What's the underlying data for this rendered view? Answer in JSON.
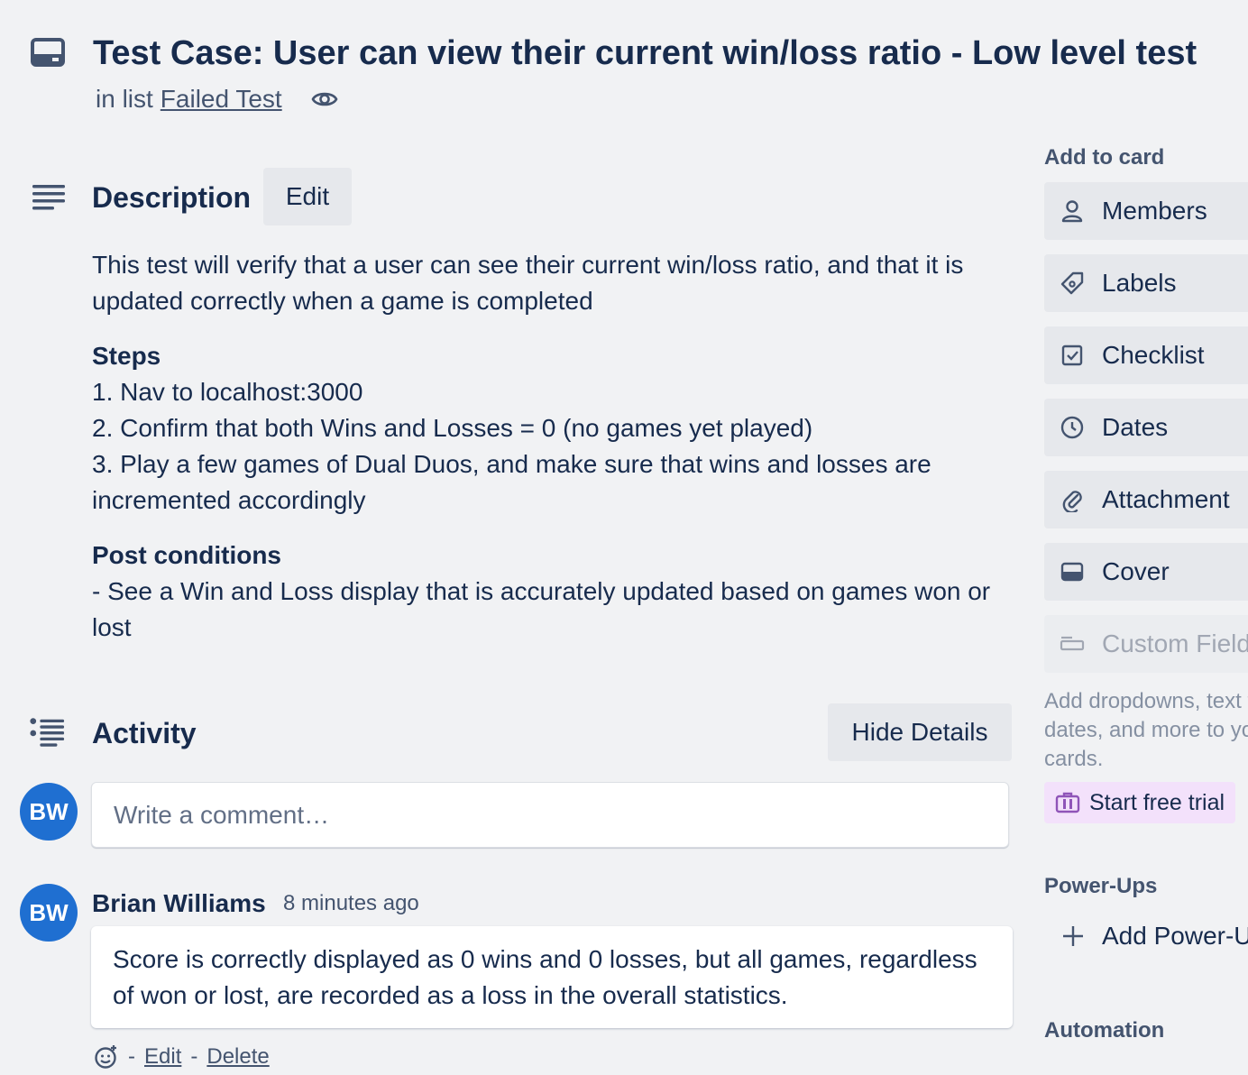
{
  "card": {
    "title": "Test Case: User can view their current win/loss ratio - Low level test",
    "list_prefix": "in list",
    "list_name": "Failed Test"
  },
  "description": {
    "heading": "Description",
    "edit_label": "Edit",
    "intro": "This test will verify that a user can see their current win/loss ratio, and that it is updated correctly when a game is completed",
    "steps_heading": "Steps",
    "steps": [
      "1. Nav to localhost:3000",
      "2. Confirm that both Wins and Losses = 0 (no games yet played)",
      "3. Play a few games of Dual Duos, and make sure that wins and losses are incremented accordingly"
    ],
    "post_heading": "Post conditions",
    "post_text": "- See a Win and Loss display that is accurately updated based on games won or lost"
  },
  "activity": {
    "heading": "Activity",
    "hide_details_label": "Hide Details",
    "user_initials": "BW",
    "comment_placeholder": "Write a comment…",
    "comments": [
      {
        "initials": "BW",
        "author": "Brian Williams",
        "time": "8 minutes ago",
        "text": "Score is correctly displayed as 0 wins and 0 losses, but all games, regardless of won or lost, are recorded as a loss in the overall statistics.",
        "sep": "-",
        "edit": "Edit",
        "delete": "Delete"
      }
    ]
  },
  "sidebar": {
    "add_to_card_label": "Add to card",
    "buttons": [
      {
        "label": "Members",
        "icon": "person-icon"
      },
      {
        "label": "Labels",
        "icon": "tag-icon"
      },
      {
        "label": "Checklist",
        "icon": "checkbox-icon"
      },
      {
        "label": "Dates",
        "icon": "clock-icon"
      },
      {
        "label": "Attachment",
        "icon": "paperclip-icon"
      },
      {
        "label": "Cover",
        "icon": "cover-icon"
      },
      {
        "label": "Custom Fields",
        "icon": "custom-field-icon"
      }
    ],
    "custom_fields_note": [
      "Add dropdowns, text fields,",
      "dates, and more to your",
      "cards."
    ],
    "start_trial_label": "Start free trial",
    "power_ups_label": "Power-Ups",
    "add_power_up_label": "Add Power-Ups",
    "automation_label": "Automation"
  },
  "colors": {
    "background": "#f1f2f4",
    "avatar": "#1f6fd1",
    "trial_bg": "#f3e1fb",
    "trial_icon": "#8f54b8",
    "text": "#172b4d"
  }
}
